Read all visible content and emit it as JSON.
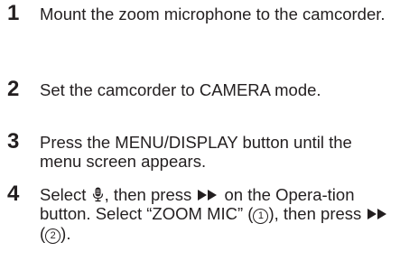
{
  "steps": [
    {
      "number": "1",
      "text": "Mount the zoom microphone to the camcorder."
    },
    {
      "number": "2",
      "text": "Set the camcorder to CAMERA mode."
    },
    {
      "number": "3",
      "text": "Press the MENU/DISPLAY button until the menu screen appears."
    },
    {
      "number": "4",
      "text_part1": "Select ",
      "icon1": "microphone-menu-icon",
      "text_part2": ", then press ",
      "icon2": "fast-forward-icon",
      "text_part3": " on the Opera-tion button. Select “ZOOM MIC” (",
      "circled1": "1",
      "text_part4": "), then press ",
      "icon3": "fast-forward-icon",
      "text_part5": " (",
      "circled2": "2",
      "text_part6": ")."
    }
  ]
}
